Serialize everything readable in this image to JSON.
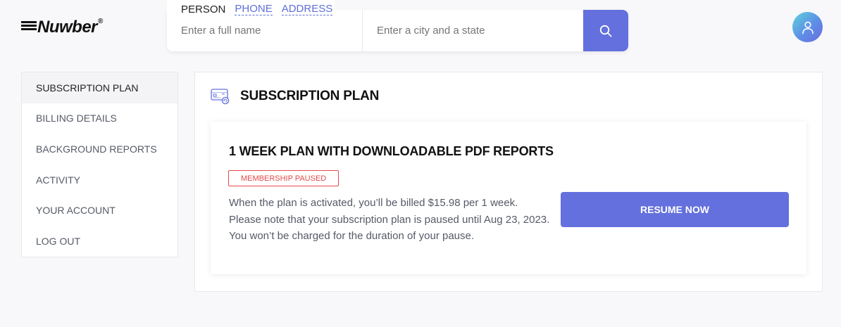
{
  "brand": {
    "name": "Nuwber",
    "registered": "®"
  },
  "search": {
    "tabs": [
      "PERSON",
      "PHONE",
      "ADDRESS"
    ],
    "name_placeholder": "Enter a full name",
    "city_placeholder": "Enter a city and a state"
  },
  "sidebar": {
    "items": [
      {
        "label": "SUBSCRIPTION PLAN"
      },
      {
        "label": "BILLING DETAILS"
      },
      {
        "label": "BACKGROUND REPORTS"
      },
      {
        "label": "ACTIVITY"
      },
      {
        "label": "YOUR ACCOUNT"
      },
      {
        "label": "LOG OUT"
      }
    ]
  },
  "main": {
    "title": "SUBSCRIPTION PLAN",
    "icon": "subscription-card-icon",
    "plan": {
      "title": "1 WEEK PLAN WITH DOWNLOADABLE PDF REPORTS",
      "status": "MEMBERSHIP PAUSED",
      "line1": "When the plan is activated, you’ll be billed $15.98 per 1 week.",
      "line2": "Please note that your subscription plan is paused until Aug 23, 2023.",
      "line3": "You won’t be charged for the duration of your pause.",
      "button": "RESUME NOW"
    }
  },
  "colors": {
    "accent": "#6370dd",
    "link": "#5f6fd8",
    "status_red": "#e5494b",
    "background": "#f8f8fa"
  }
}
